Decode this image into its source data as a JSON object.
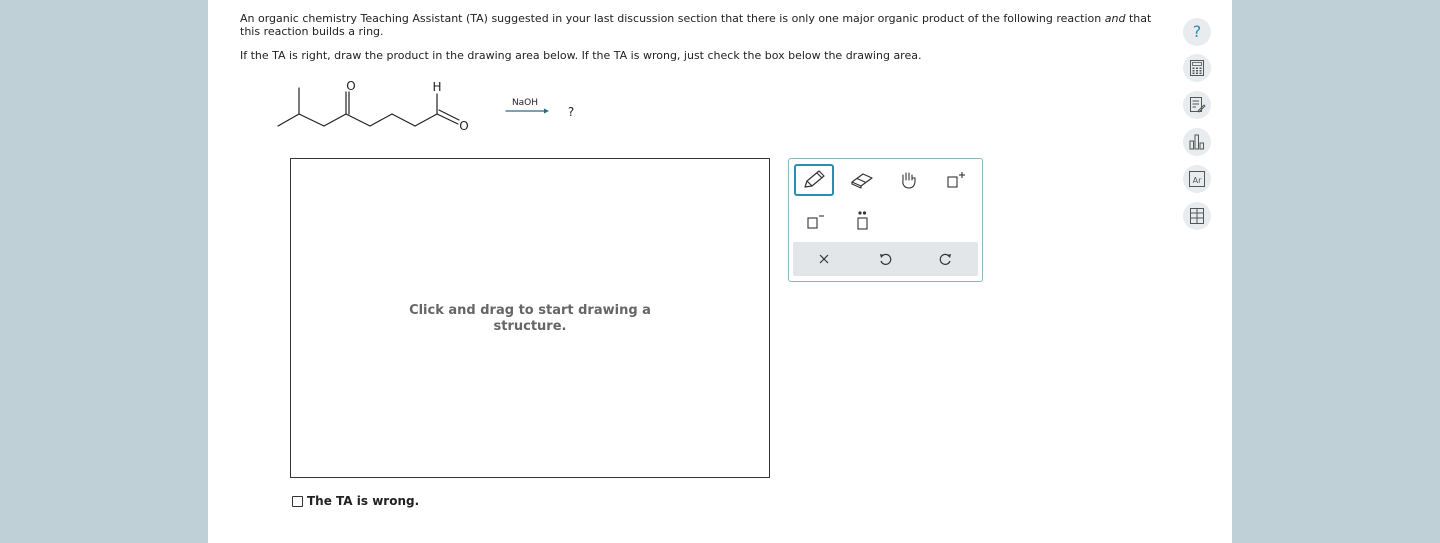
{
  "question": {
    "line1_start": "An organic chemistry Teaching Assistant (TA) suggested in your last discussion section that there is only one major organic product of the following reaction ",
    "line1_em": "and",
    "line1_end": " that this reaction builds a ring.",
    "line2": "If the TA is right, draw the product in the drawing area below. If the TA is wrong, just check the box below the drawing area."
  },
  "reaction": {
    "reagent": "NaOH",
    "product": "?",
    "atom_o1": "O",
    "atom_h": "H",
    "atom_o2": "O"
  },
  "canvas": {
    "hint_line1": "Click and drag to start drawing a",
    "hint_line2": "structure."
  },
  "tools": {
    "items": [
      "pencil-tool",
      "eraser-tool",
      "hand-tool",
      "add-charge-tool",
      "minus-charge-tool",
      "lone-pair-tool",
      "clear-tool",
      "undo-tool",
      "redo-tool"
    ]
  },
  "checkbox": {
    "label": "The TA is wrong.",
    "checked": false
  },
  "sidebar": {
    "icons": [
      "help-icon",
      "calculator-icon",
      "notes-icon",
      "chart-icon",
      "periodic-table-icon",
      "data-table-icon"
    ],
    "help_glyph": "?"
  },
  "colors": {
    "background": "#bfd0d7",
    "accent": "#2b8db0",
    "arrow": "#2b6a8a"
  }
}
